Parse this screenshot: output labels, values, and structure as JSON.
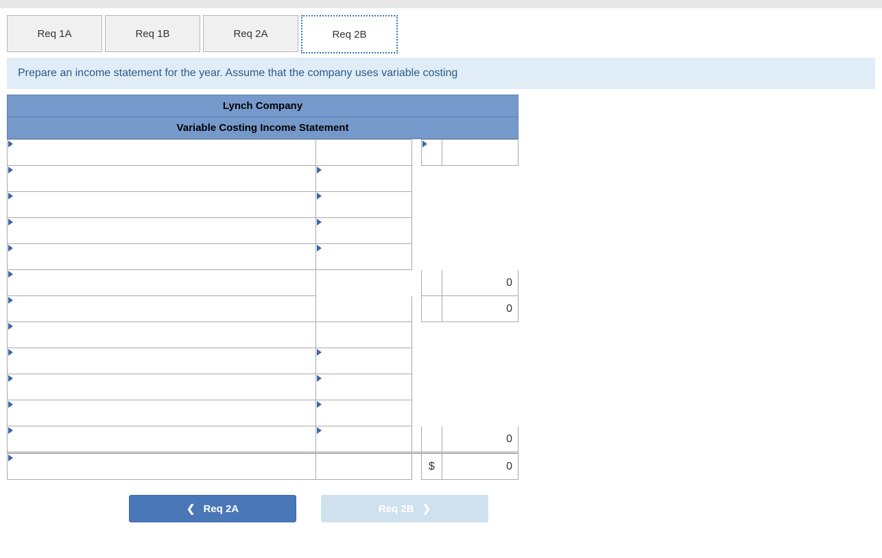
{
  "tabs": [
    {
      "label": "Req 1A",
      "active": false
    },
    {
      "label": "Req 1B",
      "active": false
    },
    {
      "label": "Req 2A",
      "active": false
    },
    {
      "label": "Req 2B",
      "active": true
    }
  ],
  "instruction": "Prepare an income statement for the year. Assume that the company uses variable costing",
  "sheet": {
    "title1": "Lynch Company",
    "title2": "Variable Costing Income Statement",
    "rows": [
      {
        "label_tri": true,
        "mid_tri": false,
        "mid_border": true,
        "cur_tri": true,
        "cur_border": true,
        "cur": "",
        "val": "",
        "val_border": true
      },
      {
        "label_tri": true,
        "mid_tri": true,
        "mid_border": true,
        "cur_tri": false,
        "cur_border": false,
        "cur": "",
        "val": "",
        "val_border": false
      },
      {
        "label_tri": true,
        "mid_tri": true,
        "mid_border": true,
        "cur_tri": false,
        "cur_border": false,
        "cur": "",
        "val": "",
        "val_border": false
      },
      {
        "label_tri": true,
        "mid_tri": true,
        "mid_border": true,
        "cur_tri": false,
        "cur_border": false,
        "cur": "",
        "val": "",
        "val_border": false
      },
      {
        "label_tri": true,
        "mid_tri": true,
        "mid_border": true,
        "cur_tri": false,
        "cur_border": false,
        "cur": "",
        "val": "",
        "val_border": false
      },
      {
        "label_tri": true,
        "mid_tri": false,
        "mid_border": false,
        "cur_tri": false,
        "cur_border": true,
        "cur": "",
        "val": "0",
        "val_border": true
      },
      {
        "label_tri": true,
        "mid_tri": false,
        "mid_border": true,
        "cur_tri": false,
        "cur_border": true,
        "cur": "",
        "val": "0",
        "val_border": true
      },
      {
        "label_tri": true,
        "mid_tri": false,
        "mid_border": true,
        "cur_tri": false,
        "cur_border": false,
        "cur": "",
        "val": "",
        "val_border": false
      },
      {
        "label_tri": true,
        "mid_tri": true,
        "mid_border": true,
        "cur_tri": false,
        "cur_border": false,
        "cur": "",
        "val": "",
        "val_border": false
      },
      {
        "label_tri": true,
        "mid_tri": true,
        "mid_border": true,
        "cur_tri": false,
        "cur_border": false,
        "cur": "",
        "val": "",
        "val_border": false
      },
      {
        "label_tri": true,
        "mid_tri": true,
        "mid_border": true,
        "cur_tri": false,
        "cur_border": false,
        "cur": "",
        "val": "",
        "val_border": false
      },
      {
        "label_tri": true,
        "mid_tri": true,
        "mid_border": true,
        "cur_tri": false,
        "cur_border": true,
        "cur": "",
        "val": "0",
        "val_border": true
      },
      {
        "label_tri": true,
        "mid_tri": false,
        "mid_border": true,
        "cur_tri": false,
        "cur_border": true,
        "cur": "$",
        "val": "0",
        "val_border": true,
        "double": true
      }
    ]
  },
  "nav": {
    "prev": "Req 2A",
    "next": "Req 2B"
  }
}
